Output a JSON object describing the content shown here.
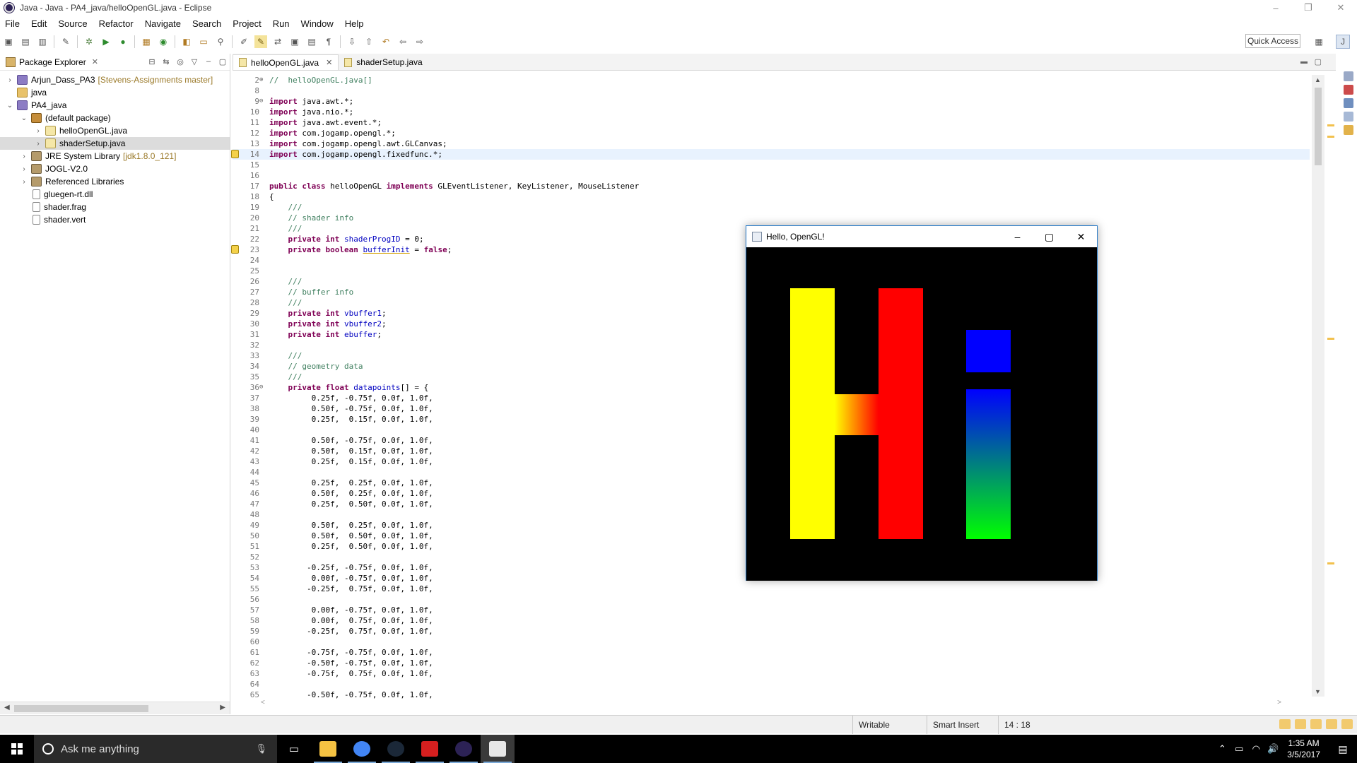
{
  "window": {
    "title": "Java - Java - PA4_java/helloOpenGL.java - Eclipse"
  },
  "menu": [
    "File",
    "Edit",
    "Source",
    "Refactor",
    "Navigate",
    "Search",
    "Project",
    "Run",
    "Window",
    "Help"
  ],
  "toolbar": {
    "quick_access": "Quick Access"
  },
  "package_explorer": {
    "title": "Package Explorer",
    "tree": [
      {
        "label": "Arjun_Dass_PA3",
        "decoration": "[Stevens-Assignments master]",
        "depth": 0,
        "twisty": "collapsed",
        "icon": "project-icon"
      },
      {
        "label": "java",
        "depth": 0,
        "twisty": "none",
        "icon": "folder-icon"
      },
      {
        "label": "PA4_java",
        "depth": 0,
        "twisty": "expanded",
        "icon": "project-icon"
      },
      {
        "label": "(default package)",
        "depth": 1,
        "twisty": "expanded",
        "icon": "package-icon"
      },
      {
        "label": "helloOpenGL.java",
        "depth": 2,
        "twisty": "collapsed",
        "icon": "java-file-icon"
      },
      {
        "label": "shaderSetup.java",
        "depth": 2,
        "twisty": "collapsed",
        "icon": "java-file-icon",
        "selected": true
      },
      {
        "label": "JRE System Library",
        "decoration": "[jdk1.8.0_121]",
        "depth": 1,
        "twisty": "collapsed",
        "icon": "library-icon"
      },
      {
        "label": "JOGL-V2.0",
        "depth": 1,
        "twisty": "collapsed",
        "icon": "library-icon"
      },
      {
        "label": "Referenced Libraries",
        "depth": 1,
        "twisty": "collapsed",
        "icon": "library-icon"
      },
      {
        "label": "gluegen-rt.dll",
        "depth": 1,
        "twisty": "none",
        "icon": "file-icon"
      },
      {
        "label": "shader.frag",
        "depth": 1,
        "twisty": "none",
        "icon": "file-icon"
      },
      {
        "label": "shader.vert",
        "depth": 1,
        "twisty": "none",
        "icon": "file-icon"
      }
    ]
  },
  "editor": {
    "tabs": [
      {
        "label": "helloOpenGL.java",
        "active": true
      },
      {
        "label": "shaderSetup.java",
        "active": false
      }
    ],
    "lines": [
      {
        "n": "2",
        "fold": "⊕",
        "t": [
          [
            "cm",
            "//  helloOpenGL.java[]"
          ]
        ]
      },
      {
        "n": "8",
        "t": []
      },
      {
        "n": "9",
        "fold": "⊖",
        "t": [
          [
            "kw",
            "import"
          ],
          [
            "",
            " java.awt.*;"
          ]
        ]
      },
      {
        "n": "10",
        "t": [
          [
            "kw",
            "import"
          ],
          [
            "",
            " java.nio.*;"
          ]
        ]
      },
      {
        "n": "11",
        "t": [
          [
            "kw",
            "import"
          ],
          [
            "",
            " java.awt.event.*;"
          ]
        ]
      },
      {
        "n": "12",
        "t": [
          [
            "kw",
            "import"
          ],
          [
            "",
            " com.jogamp.opengl.*;"
          ]
        ]
      },
      {
        "n": "13",
        "t": [
          [
            "kw",
            "import"
          ],
          [
            "",
            " com.jogamp.opengl.awt.GLCanvas;"
          ]
        ]
      },
      {
        "n": "14",
        "marker": true,
        "current": true,
        "t": [
          [
            "kw",
            "import"
          ],
          [
            "",
            " com.jogamp.opengl.fixedfunc.*;"
          ]
        ]
      },
      {
        "n": "15",
        "t": []
      },
      {
        "n": "16",
        "t": []
      },
      {
        "n": "17",
        "t": [
          [
            "kw",
            "public class"
          ],
          [
            "",
            " helloOpenGL "
          ],
          [
            "kw",
            "implements"
          ],
          [
            "",
            " GLEventListener, KeyListener, MouseListener"
          ]
        ]
      },
      {
        "n": "18",
        "t": [
          [
            "",
            "{"
          ]
        ]
      },
      {
        "n": "19",
        "t": [
          [
            "cm",
            "    ///"
          ]
        ]
      },
      {
        "n": "20",
        "t": [
          [
            "cm",
            "    // shader info"
          ]
        ]
      },
      {
        "n": "21",
        "t": [
          [
            "cm",
            "    ///"
          ]
        ]
      },
      {
        "n": "22",
        "t": [
          [
            "",
            "    "
          ],
          [
            "kw",
            "private int"
          ],
          [
            "",
            " "
          ],
          [
            "fld",
            "shaderProgID"
          ],
          [
            "",
            " = 0;"
          ]
        ]
      },
      {
        "n": "23",
        "marker": true,
        "t": [
          [
            "",
            "    "
          ],
          [
            "kw",
            "private boolean"
          ],
          [
            "",
            " "
          ],
          [
            "fld-u",
            "bufferInit"
          ],
          [
            "",
            " = "
          ],
          [
            "kw",
            "false"
          ],
          [
            "",
            ";"
          ]
        ]
      },
      {
        "n": "24",
        "t": []
      },
      {
        "n": "25",
        "t": []
      },
      {
        "n": "26",
        "t": [
          [
            "cm",
            "    ///"
          ]
        ]
      },
      {
        "n": "27",
        "t": [
          [
            "cm",
            "    // buffer info"
          ]
        ]
      },
      {
        "n": "28",
        "t": [
          [
            "cm",
            "    ///"
          ]
        ]
      },
      {
        "n": "29",
        "t": [
          [
            "",
            "    "
          ],
          [
            "kw",
            "private int"
          ],
          [
            "",
            " "
          ],
          [
            "fld",
            "vbuffer1"
          ],
          [
            "",
            ";"
          ]
        ]
      },
      {
        "n": "30",
        "t": [
          [
            "",
            "    "
          ],
          [
            "kw",
            "private int"
          ],
          [
            "",
            " "
          ],
          [
            "fld",
            "vbuffer2"
          ],
          [
            "",
            ";"
          ]
        ]
      },
      {
        "n": "31",
        "t": [
          [
            "",
            "    "
          ],
          [
            "kw",
            "private int"
          ],
          [
            "",
            " "
          ],
          [
            "fld",
            "ebuffer"
          ],
          [
            "",
            ";"
          ]
        ]
      },
      {
        "n": "32",
        "t": []
      },
      {
        "n": "33",
        "t": [
          [
            "cm",
            "    ///"
          ]
        ]
      },
      {
        "n": "34",
        "t": [
          [
            "cm",
            "    // geometry data"
          ]
        ]
      },
      {
        "n": "35",
        "t": [
          [
            "cm",
            "    ///"
          ]
        ]
      },
      {
        "n": "36",
        "fold": "⊖",
        "t": [
          [
            "",
            "    "
          ],
          [
            "kw",
            "private float"
          ],
          [
            "",
            " "
          ],
          [
            "fld",
            "datapoints"
          ],
          [
            "",
            "[] = {"
          ]
        ]
      },
      {
        "n": "37",
        "t": [
          [
            "",
            "         0.25f, -0.75f, 0.0f, 1.0f,"
          ]
        ]
      },
      {
        "n": "38",
        "t": [
          [
            "",
            "         0.50f, -0.75f, 0.0f, 1.0f,"
          ]
        ]
      },
      {
        "n": "39",
        "t": [
          [
            "",
            "         0.25f,  0.15f, 0.0f, 1.0f,"
          ]
        ]
      },
      {
        "n": "40",
        "t": []
      },
      {
        "n": "41",
        "t": [
          [
            "",
            "         0.50f, -0.75f, 0.0f, 1.0f,"
          ]
        ]
      },
      {
        "n": "42",
        "t": [
          [
            "",
            "         0.50f,  0.15f, 0.0f, 1.0f,"
          ]
        ]
      },
      {
        "n": "43",
        "t": [
          [
            "",
            "         0.25f,  0.15f, 0.0f, 1.0f,"
          ]
        ]
      },
      {
        "n": "44",
        "t": []
      },
      {
        "n": "45",
        "t": [
          [
            "",
            "         0.25f,  0.25f, 0.0f, 1.0f,"
          ]
        ]
      },
      {
        "n": "46",
        "t": [
          [
            "",
            "         0.50f,  0.25f, 0.0f, 1.0f,"
          ]
        ]
      },
      {
        "n": "47",
        "t": [
          [
            "",
            "         0.25f,  0.50f, 0.0f, 1.0f,"
          ]
        ]
      },
      {
        "n": "48",
        "t": []
      },
      {
        "n": "49",
        "t": [
          [
            "",
            "         0.50f,  0.25f, 0.0f, 1.0f,"
          ]
        ]
      },
      {
        "n": "50",
        "t": [
          [
            "",
            "         0.50f,  0.50f, 0.0f, 1.0f,"
          ]
        ]
      },
      {
        "n": "51",
        "t": [
          [
            "",
            "         0.25f,  0.50f, 0.0f, 1.0f,"
          ]
        ]
      },
      {
        "n": "52",
        "t": []
      },
      {
        "n": "53",
        "t": [
          [
            "",
            "        -0.25f, -0.75f, 0.0f, 1.0f,"
          ]
        ]
      },
      {
        "n": "54",
        "t": [
          [
            "",
            "         0.00f, -0.75f, 0.0f, 1.0f,"
          ]
        ]
      },
      {
        "n": "55",
        "t": [
          [
            "",
            "        -0.25f,  0.75f, 0.0f, 1.0f,"
          ]
        ]
      },
      {
        "n": "56",
        "t": []
      },
      {
        "n": "57",
        "t": [
          [
            "",
            "         0.00f, -0.75f, 0.0f, 1.0f,"
          ]
        ]
      },
      {
        "n": "58",
        "t": [
          [
            "",
            "         0.00f,  0.75f, 0.0f, 1.0f,"
          ]
        ]
      },
      {
        "n": "59",
        "t": [
          [
            "",
            "        -0.25f,  0.75f, 0.0f, 1.0f,"
          ]
        ]
      },
      {
        "n": "60",
        "t": []
      },
      {
        "n": "61",
        "t": [
          [
            "",
            "        -0.75f, -0.75f, 0.0f, 1.0f,"
          ]
        ]
      },
      {
        "n": "62",
        "t": [
          [
            "",
            "        -0.50f, -0.75f, 0.0f, 1.0f,"
          ]
        ]
      },
      {
        "n": "63",
        "t": [
          [
            "",
            "        -0.75f,  0.75f, 0.0f, 1.0f,"
          ]
        ]
      },
      {
        "n": "64",
        "t": []
      },
      {
        "n": "65",
        "t": [
          [
            "",
            "        -0.50f, -0.75f, 0.0f, 1.0f,"
          ]
        ]
      }
    ]
  },
  "gl_window": {
    "title": "Hello, OpenGL!",
    "shapes": [
      {
        "name": "h-left-bar",
        "fill": "#ffff00"
      },
      {
        "name": "h-crossbar",
        "fill": "linear-gradient(to right, #ffff00, #ff0000)"
      },
      {
        "name": "h-right-bar",
        "fill": "#ff0000"
      },
      {
        "name": "i-dot",
        "fill": "#0000ff"
      },
      {
        "name": "i-stem",
        "fill": "linear-gradient(to bottom, #0000ff, #00ff00)"
      }
    ]
  },
  "status_bar": {
    "writable": "Writable",
    "insert_mode": "Smart Insert",
    "position": "14 : 18"
  },
  "taskbar": {
    "search_placeholder": "Ask me anything",
    "apps": [
      {
        "name": "file-explorer",
        "color": "#f5c242",
        "open": true
      },
      {
        "name": "chrome",
        "color": "#4285f4",
        "open": true
      },
      {
        "name": "steam",
        "color": "#1b2838",
        "open": true
      },
      {
        "name": "acrobat",
        "color": "#d61f1f",
        "open": true
      },
      {
        "name": "eclipse",
        "color": "#2c2255",
        "open": true
      },
      {
        "name": "java",
        "color": "#e8e8e8",
        "open": true,
        "active": true
      }
    ],
    "time": "1:35 AM",
    "date": "3/5/2017"
  }
}
